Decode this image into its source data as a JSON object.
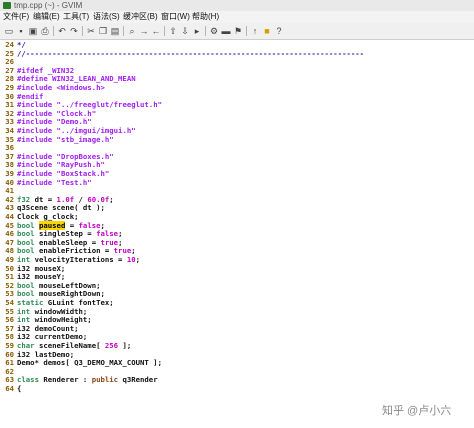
{
  "window": {
    "title": "tmp.cpp (~) - GVIM"
  },
  "menu": [
    "文件(F)",
    "编辑(E)",
    "工具(T)",
    "语法(S)",
    "缓冲区(B)",
    "窗口(W)",
    "帮助(H)"
  ],
  "toolbar_icons": [
    "open-icon",
    "save-icon",
    "save-all-icon",
    "print-icon",
    "undo-icon",
    "redo-icon",
    "cut-icon",
    "copy-icon",
    "paste-icon",
    "find-icon",
    "find-next-icon",
    "find-prev-icon",
    "load-session-icon",
    "save-session-icon",
    "run-script-icon",
    "make-icon",
    "shell-icon",
    "make-tags-icon",
    "jump-tag-icon",
    "help-icon",
    "find-help-icon"
  ],
  "lines": [
    {
      "n": "24",
      "segs": [
        {
          "t": "*/",
          "c": "cmt"
        }
      ]
    },
    {
      "n": "25",
      "segs": [
        {
          "t": "//-----------------------------------------------------------------------------",
          "c": "cmt"
        }
      ]
    },
    {
      "n": "26",
      "segs": []
    },
    {
      "n": "27",
      "segs": [
        {
          "t": "#ifdef _WIN32",
          "c": "pre"
        }
      ]
    },
    {
      "n": "28",
      "segs": [
        {
          "t": "#define WIN32_LEAN_AND_MEAN",
          "c": "pre"
        }
      ]
    },
    {
      "n": "29",
      "segs": [
        {
          "t": "#include <Windows.h>",
          "c": "pre"
        }
      ]
    },
    {
      "n": "30",
      "segs": [
        {
          "t": "#endif",
          "c": "pre"
        }
      ]
    },
    {
      "n": "31",
      "segs": [
        {
          "t": "#include ",
          "c": "pre"
        },
        {
          "t": "\"../freeglut/freeglut.h\"",
          "c": "str"
        }
      ]
    },
    {
      "n": "32",
      "segs": [
        {
          "t": "#include ",
          "c": "pre"
        },
        {
          "t": "\"Clock.h\"",
          "c": "str"
        }
      ]
    },
    {
      "n": "33",
      "segs": [
        {
          "t": "#include ",
          "c": "pre"
        },
        {
          "t": "\"Demo.h\"",
          "c": "str"
        }
      ]
    },
    {
      "n": "34",
      "segs": [
        {
          "t": "#include ",
          "c": "pre"
        },
        {
          "t": "\"../imgui/imgui.h\"",
          "c": "str"
        }
      ]
    },
    {
      "n": "35",
      "segs": [
        {
          "t": "#include ",
          "c": "pre"
        },
        {
          "t": "\"stb_image.h\"",
          "c": "str"
        }
      ]
    },
    {
      "n": "36",
      "segs": []
    },
    {
      "n": "37",
      "segs": [
        {
          "t": "#include ",
          "c": "pre"
        },
        {
          "t": "\"DropBoxes.h\"",
          "c": "str"
        }
      ]
    },
    {
      "n": "38",
      "segs": [
        {
          "t": "#include ",
          "c": "pre"
        },
        {
          "t": "\"RayPush.h\"",
          "c": "str"
        }
      ]
    },
    {
      "n": "39",
      "segs": [
        {
          "t": "#include ",
          "c": "pre"
        },
        {
          "t": "\"BoxStack.h\"",
          "c": "str"
        }
      ]
    },
    {
      "n": "40",
      "segs": [
        {
          "t": "#include ",
          "c": "pre"
        },
        {
          "t": "\"Test.h\"",
          "c": "str"
        }
      ]
    },
    {
      "n": "41",
      "segs": []
    },
    {
      "n": "42",
      "segs": [
        {
          "t": "f32",
          "c": "typ"
        },
        {
          "t": " dt = ",
          "c": "def"
        },
        {
          "t": "1.0f",
          "c": "num"
        },
        {
          "t": " / ",
          "c": "def"
        },
        {
          "t": "60.0f",
          "c": "num"
        },
        {
          "t": ";",
          "c": "def"
        }
      ]
    },
    {
      "n": "43",
      "segs": [
        {
          "t": "q3Scene scene( dt );",
          "c": "def"
        }
      ]
    },
    {
      "n": "44",
      "segs": [
        {
          "t": "Clock g_clock;",
          "c": "def"
        }
      ]
    },
    {
      "n": "45",
      "segs": [
        {
          "t": "bool",
          "c": "typ"
        },
        {
          "t": " ",
          "c": "def"
        },
        {
          "t": "paused",
          "c": "hl"
        },
        {
          "t": " = ",
          "c": "def"
        },
        {
          "t": "false",
          "c": "num"
        },
        {
          "t": ";",
          "c": "def"
        }
      ]
    },
    {
      "n": "46",
      "segs": [
        {
          "t": "bool",
          "c": "typ"
        },
        {
          "t": " singleStep = ",
          "c": "def"
        },
        {
          "t": "false",
          "c": "num"
        },
        {
          "t": ";",
          "c": "def"
        }
      ]
    },
    {
      "n": "47",
      "segs": [
        {
          "t": "bool",
          "c": "typ"
        },
        {
          "t": " enableSleep = ",
          "c": "def"
        },
        {
          "t": "true",
          "c": "num"
        },
        {
          "t": ";",
          "c": "def"
        }
      ]
    },
    {
      "n": "48",
      "segs": [
        {
          "t": "bool",
          "c": "typ"
        },
        {
          "t": " enableFriction = ",
          "c": "def"
        },
        {
          "t": "true",
          "c": "num"
        },
        {
          "t": ";",
          "c": "def"
        }
      ]
    },
    {
      "n": "49",
      "segs": [
        {
          "t": "int",
          "c": "typ"
        },
        {
          "t": " velocityIterations = ",
          "c": "def"
        },
        {
          "t": "10",
          "c": "num"
        },
        {
          "t": ";",
          "c": "def"
        }
      ]
    },
    {
      "n": "50",
      "segs": [
        {
          "t": "i32 mouseX;",
          "c": "def"
        }
      ]
    },
    {
      "n": "51",
      "segs": [
        {
          "t": "i32 mouseY;",
          "c": "def"
        }
      ]
    },
    {
      "n": "52",
      "segs": [
        {
          "t": "bool",
          "c": "typ"
        },
        {
          "t": " mouseLeftDown;",
          "c": "def"
        }
      ]
    },
    {
      "n": "53",
      "segs": [
        {
          "t": "bool",
          "c": "typ"
        },
        {
          "t": " mouseRightDown;",
          "c": "def"
        }
      ]
    },
    {
      "n": "54",
      "segs": [
        {
          "t": "static",
          "c": "typ"
        },
        {
          "t": " GLuint fontTex;",
          "c": "def"
        }
      ]
    },
    {
      "n": "55",
      "segs": [
        {
          "t": "int",
          "c": "typ"
        },
        {
          "t": " windowWidth;",
          "c": "def"
        }
      ]
    },
    {
      "n": "56",
      "segs": [
        {
          "t": "int",
          "c": "typ"
        },
        {
          "t": " windowHeight;",
          "c": "def"
        }
      ]
    },
    {
      "n": "57",
      "segs": [
        {
          "t": "i32 demoCount;",
          "c": "def"
        }
      ]
    },
    {
      "n": "58",
      "segs": [
        {
          "t": "i32 currentDemo;",
          "c": "def"
        }
      ]
    },
    {
      "n": "59",
      "segs": [
        {
          "t": "char",
          "c": "typ"
        },
        {
          "t": " sceneFileName[ ",
          "c": "def"
        },
        {
          "t": "256",
          "c": "num"
        },
        {
          "t": " ];",
          "c": "def"
        }
      ]
    },
    {
      "n": "60",
      "segs": [
        {
          "t": "i32 lastDemo;",
          "c": "def"
        }
      ]
    },
    {
      "n": "61",
      "segs": [
        {
          "t": "Demo* demos[ Q3_DEMO_MAX_COUNT ];",
          "c": "def"
        }
      ]
    },
    {
      "n": "62",
      "segs": []
    },
    {
      "n": "63",
      "segs": [
        {
          "t": "class",
          "c": "typ"
        },
        {
          "t": " Renderer : ",
          "c": "def"
        },
        {
          "t": "public",
          "c": "kw"
        },
        {
          "t": " q3Render",
          "c": "def"
        }
      ]
    },
    {
      "n": "64",
      "segs": [
        {
          "t": "{",
          "c": "def"
        }
      ]
    }
  ],
  "watermark": "知乎 @卢小六"
}
